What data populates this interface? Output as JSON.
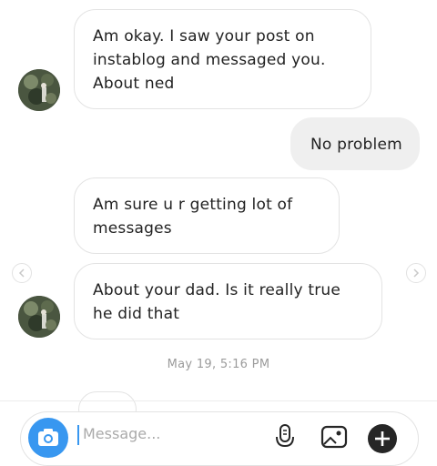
{
  "messages": [
    {
      "direction": "incoming",
      "lines": [
        "Am okay. I saw your post on",
        "instablog and messaged you.",
        "About ned"
      ]
    },
    {
      "direction": "outgoing",
      "lines": [
        "No problem"
      ]
    },
    {
      "direction": "incoming",
      "lines": [
        "Am sure u r getting lot of",
        "messages"
      ]
    },
    {
      "direction": "incoming",
      "lines": [
        "About your dad. Is it really true",
        "he did that"
      ]
    }
  ],
  "timestamp": "May 19, 5:16 PM",
  "composer": {
    "placeholder": "Message...",
    "icons": [
      "camera-icon",
      "microphone-icon",
      "gallery-icon",
      "add-icon"
    ]
  },
  "colors": {
    "accent": "#3897f0",
    "bubble_border": "#e3e3e3",
    "outgoing_bubble": "#efefef",
    "timestamp": "#9b9b9b"
  }
}
